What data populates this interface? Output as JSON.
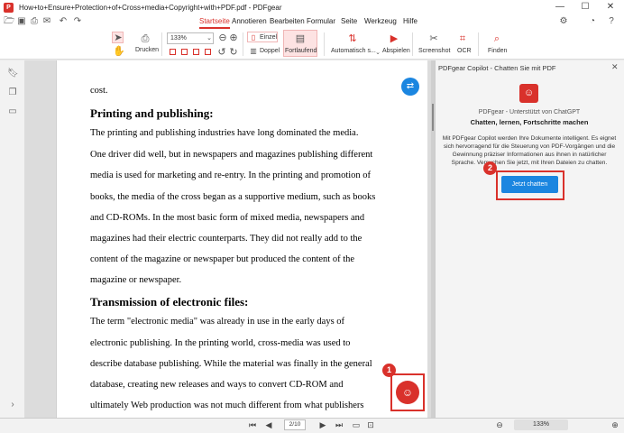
{
  "window": {
    "title": "How+to+Ensure+Protection+of+Cross+media+Copyright+with+PDF.pdf - PDFgear",
    "minimize": "—",
    "maximize": "☐",
    "close": "✕"
  },
  "menu": {
    "tabs": [
      "Startseite",
      "Annotieren",
      "Bearbeiten",
      "Formular",
      "Seite",
      "Werkzeug",
      "Hilfe"
    ],
    "active": "Startseite"
  },
  "ribbon": {
    "print": "Drucken",
    "zoom_value": "133%",
    "single": "Einzel",
    "double": "Doppel",
    "continuous": "Fortlaufend",
    "auto_scroll": "Automatisch s...",
    "play": "Abspielen",
    "screenshot": "Screenshot",
    "ocr": "OCR",
    "find": "Finden"
  },
  "document": {
    "lines": [
      {
        "text": "cost.",
        "kind": "body"
      },
      {
        "text": "Printing and publishing:",
        "kind": "heading"
      },
      {
        "text": "The printing and publishing industries have long dominated the media.",
        "kind": "body"
      },
      {
        "text": "One driver did well, but in newspapers and magazines publishing different",
        "kind": "body"
      },
      {
        "text": "media is used for marketing and re-entry. In the printing and promotion of",
        "kind": "body"
      },
      {
        "text": "books, the media of the cross began as a supportive medium, such as books",
        "kind": "body"
      },
      {
        "text": "and CD-ROMs. In the most basic form of mixed media, newspapers and",
        "kind": "body"
      },
      {
        "text": "magazines had their electric counterparts. They did not really add to the",
        "kind": "body"
      },
      {
        "text": "content of the magazine or newspaper but produced the content of the",
        "kind": "body"
      },
      {
        "text": "magazine or newspaper.",
        "kind": "body"
      },
      {
        "text": "Transmission of electronic files:",
        "kind": "heading"
      },
      {
        "text": "The term \"electronic media\" was already in use in the early days of",
        "kind": "body"
      },
      {
        "text": "electronic publishing. In the printing world, cross-media was used to",
        "kind": "body"
      },
      {
        "text": "describe database publishing. While the material was finally in the general",
        "kind": "body"
      },
      {
        "text": "database, creating new releases and ways to convert CD-ROM and",
        "kind": "body"
      },
      {
        "text": "ultimately Web production was not much different from what publishers",
        "kind": "body"
      }
    ]
  },
  "badges": {
    "one": "1",
    "two": "2"
  },
  "copilot": {
    "header": "PDFgear Copilot - Chatten Sie mit PDF",
    "powered": "PDFgear - Unterstützt von ChatGPT",
    "tagline": "Chatten, lernen, Fortschritte machen",
    "description": "Mit PDFgear Copilot werden Ihre Dokumente intelligent. Es eignet sich hervorragend für die Steuerung von PDF-Vorgängen und die Gewinnung präziser Informationen aus ihnen in natürlicher Sprache. Versuchen Sie jetzt, mit Ihren Dateien zu chatten.",
    "button": "Jetzt chatten"
  },
  "status": {
    "page": "2/10",
    "zoom": "133%"
  },
  "colors": {
    "accent": "#d9312b",
    "primary_button": "#1b86e0"
  }
}
